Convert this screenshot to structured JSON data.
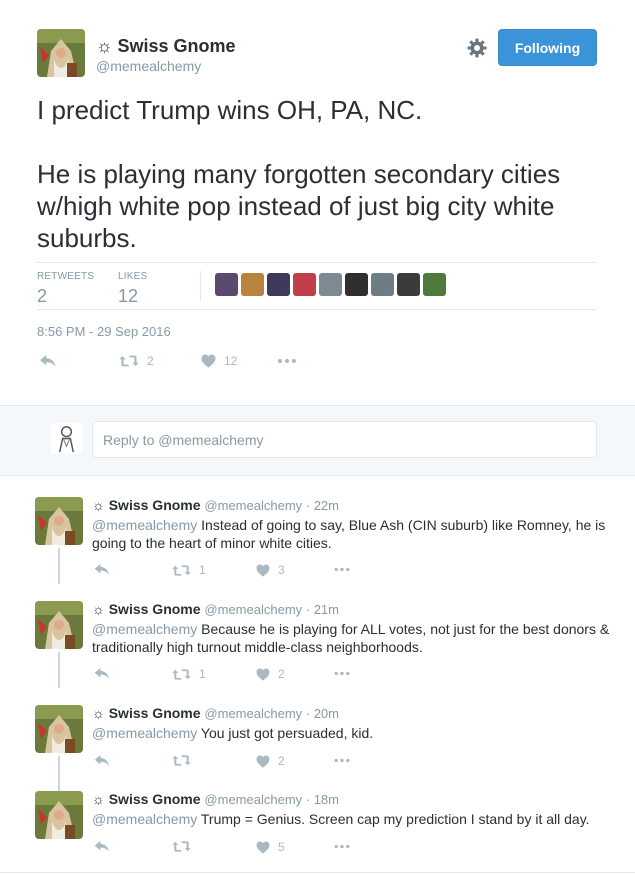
{
  "main_tweet": {
    "display_name": "☼ Swiss Gnome",
    "handle": "@memealchemy",
    "follow_label": "Following",
    "text_paragraphs": [
      "I predict Trump wins OH, PA, NC.",
      "He is playing many forgotten secondary cities w/high white pop instead of just big city white suburbs."
    ],
    "retweets_label": "RETWEETS",
    "retweets_count": "2",
    "likes_label": "LIKES",
    "likes_count": "12",
    "timestamp": "8:56 PM - 29 Sep 2016",
    "actions": {
      "retweet_count": "2",
      "like_count": "12"
    },
    "liker_colors": [
      "#5b4a6e",
      "#b7833f",
      "#3e3a5c",
      "#c13f4b",
      "#7d8a92",
      "#2f2f2f",
      "#6e7c86",
      "#3b3b3b",
      "#4f7a3e"
    ]
  },
  "reply_box": {
    "placeholder": "Reply to @memealchemy"
  },
  "replies": [
    {
      "display_name": "☼ Swiss Gnome",
      "meta": "@memealchemy · 22m",
      "mention": "@memealchemy",
      "text": "Instead of going to say, Blue Ash (CIN suburb) like Romney, he is going to the heart of minor white cities.",
      "retweet_count": "1",
      "like_count": "3"
    },
    {
      "display_name": "☼ Swiss Gnome",
      "meta": "@memealchemy · 21m",
      "mention": "@memealchemy",
      "text": "Because he is playing for ALL votes, not just for the best donors & traditionally high turnout middle-class neighborhoods.",
      "retweet_count": "1",
      "like_count": "2"
    },
    {
      "display_name": "☼ Swiss Gnome",
      "meta": "@memealchemy · 20m",
      "mention": "@memealchemy",
      "text": "You just got persuaded, kid.",
      "retweet_count": "",
      "like_count": "2"
    },
    {
      "display_name": "☼ Swiss Gnome",
      "meta": "@memealchemy · 18m",
      "mention": "@memealchemy",
      "text": "Trump = Genius.  Screen cap my prediction I stand by it all day.",
      "retweet_count": "",
      "like_count": "5"
    }
  ],
  "colors": {
    "accent": "#3b94d9",
    "muted": "#8899a6",
    "icon": "#aab8c2",
    "text": "#292f33"
  },
  "icons": {
    "reply": "reply-arrow-icon",
    "retweet": "retweet-icon",
    "like": "heart-icon",
    "more": "more-dots-icon",
    "settings": "gear-icon"
  }
}
